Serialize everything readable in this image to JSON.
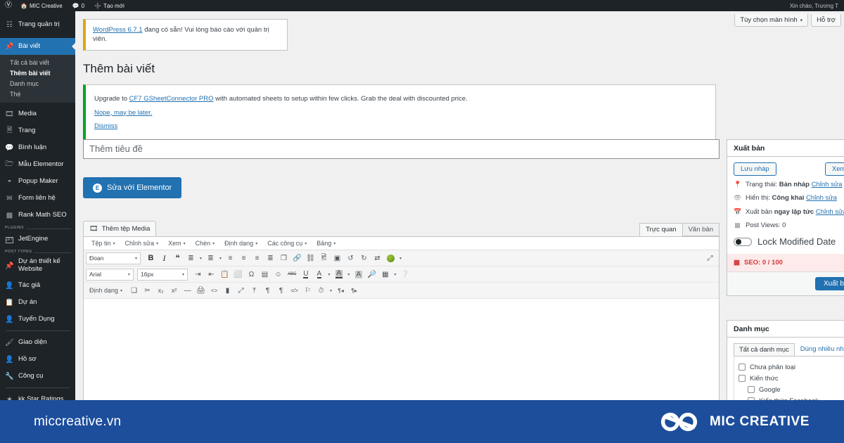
{
  "adminbar": {
    "wp_logo_icon": "wordpress-logo-icon",
    "site_icon": "home-icon",
    "site_name": "MIC Creative",
    "comment_icon": "comment-bubble-icon",
    "comment_count": "0",
    "new_icon": "plus-icon",
    "new_label": "Tạo mới",
    "greeting": "Xin chào, Trương T"
  },
  "header_buttons": [
    {
      "label": "Tùy chọn màn hình",
      "caret": "▾",
      "name": "screen-options-button"
    },
    {
      "label": "Hỗ trợ",
      "caret": "",
      "name": "help-button"
    }
  ],
  "sidebar": {
    "items": [
      {
        "label": "Trang quản trị",
        "icon": "dashboard-icon",
        "glyph": "⊞",
        "name": "sidebar-item-dashboard"
      },
      {
        "label": "Bài viết",
        "icon": "pin-icon",
        "glyph": "📌",
        "name": "sidebar-item-posts",
        "current": true
      },
      {
        "label": "Media",
        "icon": "media-icon",
        "glyph": "🖼",
        "name": "sidebar-item-media"
      },
      {
        "label": "Trang",
        "icon": "page-icon",
        "glyph": "📄",
        "name": "sidebar-item-pages"
      },
      {
        "label": "Bình luận",
        "icon": "comment-bubble-icon",
        "glyph": "💬",
        "name": "sidebar-item-comments"
      },
      {
        "label": "Mẫu Elementor",
        "icon": "folder-icon",
        "glyph": "🗀",
        "name": "sidebar-item-elementor-templates"
      },
      {
        "label": "Popup Maker",
        "icon": "popup-icon",
        "glyph": "◔",
        "name": "sidebar-item-popup-maker"
      },
      {
        "label": "Form liên hệ",
        "icon": "envelope-icon",
        "glyph": "✉",
        "name": "sidebar-item-contact-form"
      },
      {
        "label": "Rank Math SEO",
        "icon": "bar-chart-icon",
        "glyph": "📶",
        "name": "sidebar-item-rank-math-seo"
      },
      {
        "label": "JetEngine",
        "icon": "jetengine-icon",
        "glyph": "JET",
        "name": "sidebar-item-jetengine"
      },
      {
        "label": "Dự án thiết kế Website",
        "icon": "pin-icon",
        "glyph": "📌",
        "name": "sidebar-item-website-projects",
        "tall": true
      },
      {
        "label": "Tác giả",
        "icon": "user-icon",
        "glyph": "👤",
        "name": "sidebar-item-authors"
      },
      {
        "label": "Dự án",
        "icon": "clipboard-icon",
        "glyph": "📋",
        "name": "sidebar-item-projects"
      },
      {
        "label": "Tuyển Dụng",
        "icon": "user-icon",
        "glyph": "👤",
        "name": "sidebar-item-recruitment"
      },
      {
        "label": "Giao diện",
        "icon": "appearance-brush-icon",
        "glyph": "🖌",
        "name": "sidebar-item-appearance"
      },
      {
        "label": "Hồ sơ",
        "icon": "user-icon",
        "glyph": "👤",
        "name": "sidebar-item-profile"
      },
      {
        "label": "Công cụ",
        "icon": "wrench-icon",
        "glyph": "🔧",
        "name": "sidebar-item-tools"
      },
      {
        "label": "kk Star Ratings",
        "icon": "star-icon",
        "glyph": "★",
        "name": "sidebar-item-kk-star-ratings"
      }
    ],
    "submenu": [
      {
        "label": "Tất cả bài viết",
        "name": "submenu-all-posts",
        "active": false
      },
      {
        "label": "Thêm bài viết",
        "name": "submenu-add-post",
        "active": true
      },
      {
        "label": "Danh mục",
        "name": "submenu-categories",
        "active": false
      },
      {
        "label": "Thẻ",
        "name": "submenu-tags",
        "active": false
      }
    ],
    "group_labels": {
      "plugins": "PLUGINS",
      "post_types": "POST TYPES"
    }
  },
  "notice_update": {
    "link": "WordPress 6.7.1",
    "text": " đang có sẵn! Vui lòng báo cáo với quản trị viên."
  },
  "page": {
    "title": "Thêm bài viết"
  },
  "notice_plugin": {
    "pre": "Upgrade to ",
    "link": "CF7 GSheetConnector PRO",
    "post": " with automated sheets to setup within few clicks. Grab the deal with discounted price.",
    "action1": "Nope, may be later.",
    "action2": "Dismiss"
  },
  "editor": {
    "title_placeholder": "Thêm tiêu đề",
    "title_value": "",
    "elementor_button": "Sửa với Elementor",
    "elementor_badge": "E",
    "add_media": "Thêm tệp Media",
    "add_media_icon": "media-icon",
    "tabs": [
      {
        "label": "Trực quan",
        "active": true,
        "name": "tab-visual"
      },
      {
        "label": "Văn bản",
        "active": false,
        "name": "tab-text"
      }
    ],
    "menus": [
      {
        "label": "Tệp tin",
        "name": "editor-menu-file"
      },
      {
        "label": "Chỉnh sửa",
        "name": "editor-menu-edit"
      },
      {
        "label": "Xem",
        "name": "editor-menu-view"
      },
      {
        "label": "Chèn",
        "name": "editor-menu-insert"
      },
      {
        "label": "Định dạng",
        "name": "editor-menu-format"
      },
      {
        "label": "Các công cụ",
        "name": "editor-menu-tools"
      },
      {
        "label": "Bảng",
        "name": "editor-menu-table"
      }
    ],
    "row1": {
      "style_select": "Đoạn",
      "buttons": [
        {
          "glyph": "B",
          "name": "bold-icon",
          "style": "font-weight:bold;font-size:11px;color:#2c3338"
        },
        {
          "glyph": "I",
          "name": "italic-icon",
          "style": "font-style:italic;font-family:'Liberation Serif',serif;font-size:12px;color:#2c3338"
        },
        {
          "glyph": "❝",
          "name": "blockquote-icon",
          "style": "font-size:12px"
        },
        {
          "glyph": "☰",
          "name": "bullet-list-icon",
          "style": ""
        },
        {
          "glyph": "▾",
          "name": "bullet-list-caret-icon",
          "style": "caret"
        },
        {
          "glyph": "☰",
          "name": "numbered-list-icon",
          "style": ""
        },
        {
          "glyph": "▾",
          "name": "numbered-list-caret-icon",
          "style": "caret"
        },
        {
          "glyph": "≡",
          "name": "align-left-icon",
          "style": ""
        },
        {
          "glyph": "≡",
          "name": "align-center-icon",
          "style": ""
        },
        {
          "glyph": "≡",
          "name": "align-right-icon",
          "style": ""
        },
        {
          "glyph": "≣",
          "name": "align-justify-icon",
          "style": ""
        },
        {
          "glyph": "❐",
          "name": "copy-icon",
          "style": ""
        },
        {
          "glyph": "🔗",
          "name": "insert-link-icon",
          "style": ""
        },
        {
          "glyph": "⛓",
          "name": "remove-link-icon",
          "style": ""
        },
        {
          "glyph": "🖼",
          "name": "insert-image-icon",
          "style": ""
        },
        {
          "glyph": "▣",
          "name": "read-more-icon",
          "style": ""
        },
        {
          "glyph": "↺",
          "name": "undo-icon",
          "style": ""
        },
        {
          "glyph": "↻",
          "name": "redo-icon",
          "style": ""
        },
        {
          "glyph": "⇄",
          "name": "shortcode-icon",
          "style": ""
        }
      ],
      "leaf_icon": "green-leaf-icon",
      "expand_icon": "fullscreen-expand-icon"
    },
    "row2": {
      "font_select": "Arial",
      "size_select": "16px",
      "buttons": [
        {
          "glyph": "⇥",
          "name": "increase-indent-icon"
        },
        {
          "glyph": "⇤",
          "name": "decrease-indent-icon"
        },
        {
          "glyph": "📋",
          "name": "paste-as-text-icon"
        },
        {
          "glyph": "🧽",
          "name": "clear-formatting-icon"
        },
        {
          "glyph": "Ω",
          "name": "special-character-icon"
        },
        {
          "glyph": "▤",
          "name": "insert-horizontal-line-icon"
        },
        {
          "glyph": "☺",
          "name": "emoticon-icon"
        },
        {
          "glyph": "ABC",
          "name": "strikethrough-abc-icon"
        },
        {
          "glyph": "U",
          "name": "underline-icon"
        },
        {
          "glyph": "A",
          "name": "text-color-icon"
        },
        {
          "glyph": "▾",
          "name": "text-color-caret-icon"
        },
        {
          "glyph": "A",
          "name": "highlight-color-icon"
        },
        {
          "glyph": "▾",
          "name": "highlight-color-caret-icon"
        },
        {
          "glyph": "A",
          "name": "background-color-icon"
        },
        {
          "glyph": "🔍",
          "name": "search-replace-icon"
        },
        {
          "glyph": "⛁",
          "name": "insert-table-icon"
        },
        {
          "glyph": "▾",
          "name": "insert-table-caret-icon"
        },
        {
          "glyph": "?",
          "name": "help-circle-icon"
        }
      ]
    },
    "row3": {
      "format_select": "Định dạng",
      "buttons": [
        {
          "glyph": "❏",
          "name": "duplicate-icon"
        },
        {
          "glyph": "✂",
          "name": "cut-icon"
        },
        {
          "glyph": "x₂",
          "name": "subscript-icon"
        },
        {
          "glyph": "x²",
          "name": "superscript-icon"
        },
        {
          "glyph": "—",
          "name": "horizontal-rule-icon"
        },
        {
          "glyph": "🖨",
          "name": "print-icon"
        },
        {
          "glyph": "<>",
          "name": "source-code-icon"
        },
        {
          "glyph": "▮",
          "name": "page-break-icon"
        },
        {
          "glyph": "⤢",
          "name": "fullscreen-icon"
        },
        {
          "glyph": "⤒",
          "name": "upload-icon"
        },
        {
          "glyph": "¶",
          "name": "paragraph-icon"
        },
        {
          "glyph": "¶",
          "name": "show-invisible-icon"
        },
        {
          "glyph": "◇",
          "name": "code-sample-icon"
        },
        {
          "glyph": "⚑",
          "name": "anchor-icon"
        },
        {
          "glyph": "⏱",
          "name": "insert-datetime-icon"
        },
        {
          "glyph": "▾",
          "name": "insert-datetime-caret-icon"
        },
        {
          "glyph": "¶◂",
          "name": "ltr-icon"
        },
        {
          "glyph": "¶▸",
          "name": "rtl-icon"
        }
      ]
    }
  },
  "publish_panel": {
    "title": "Xuất bản",
    "collapse_up_icon": "chevron-up-icon",
    "collapse_down_icon": "chevron-down-icon",
    "save_draft": "Lưu nháp",
    "preview": "Xem th",
    "status": {
      "icon": "pin-marker-icon",
      "label": "Trạng thái:",
      "value": "Bản nháp",
      "edit": "Chỉnh sửa"
    },
    "visibility": {
      "icon": "eye-icon",
      "label": "Hiển thị:",
      "value": "Công khai",
      "edit": "Chỉnh sửa"
    },
    "schedule": {
      "icon": "calendar-icon",
      "label": "Xuất bản",
      "value": "ngay lập tức",
      "edit": "Chỉnh sửa"
    },
    "post_views": {
      "icon": "bar-chart-icon",
      "label": "Post Views: 0"
    },
    "lock_modified": {
      "label": "Lock Modified Date",
      "on": false
    },
    "seo": {
      "icon": "rank-math-icon",
      "label": "SEO: 0 / 100",
      "color": "#d63638"
    },
    "publish_button": "Xuất bản"
  },
  "category_panel": {
    "title": "Danh mục",
    "tabs": [
      {
        "label": "Tất cả danh mục",
        "active": true,
        "name": "tab-all-categories"
      },
      {
        "label": "Dùng nhiều nhất",
        "active": false,
        "name": "tab-most-used"
      }
    ],
    "items": [
      {
        "label": "Chưa phân loại",
        "indent": 0,
        "checked": false
      },
      {
        "label": "Kiến thức",
        "indent": 0,
        "checked": false
      },
      {
        "label": "Google",
        "indent": 1,
        "checked": false
      },
      {
        "label": "Kiến thức Facebook",
        "indent": 1,
        "checked": false
      }
    ]
  },
  "footer": {
    "domain": "miccreative.vn",
    "brand": "MIC CREATIVE",
    "logo_icon": "mic-creative-infinity-logo-icon",
    "bg": "#1d4e9c"
  }
}
